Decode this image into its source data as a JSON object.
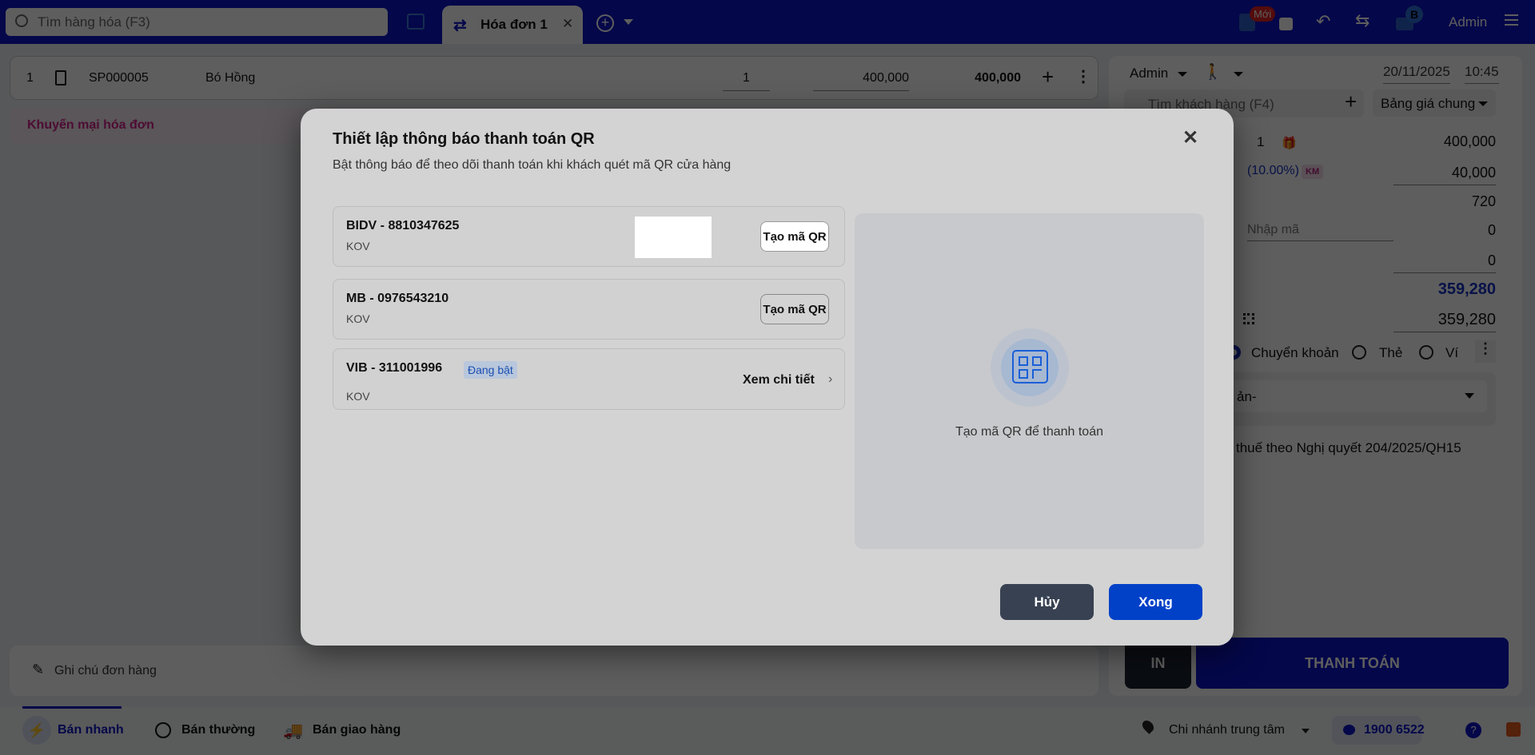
{
  "topbar": {
    "search_placeholder": "Tìm hàng hóa (F3)",
    "tab_label": "Hóa đơn 1",
    "new_badge": "Mới",
    "printer_badge": "B",
    "user": "Admin"
  },
  "cart": {
    "row": {
      "index": "1",
      "code": "SP000005",
      "name": "Bó Hồng",
      "qty": "1",
      "price": "400,000",
      "total": "400,000"
    },
    "promo_label": "Khuyến mại hóa đơn",
    "note_label": "Ghi chú đơn hàng"
  },
  "panel": {
    "staff": "Admin",
    "date": "20/11/2025",
    "time": "10:45",
    "customer_placeholder": "Tìm khách hàng (F4)",
    "price_list": "Bảng giá chung",
    "qty": "1",
    "subtotal": "400,000",
    "discount_pct": "(10.00%)",
    "km_badge": "KM",
    "discount": "40,000",
    "tax": "720",
    "coupon_placeholder": "Nhập mã",
    "coupon_value": "0",
    "other": "0",
    "payable": "359,280",
    "paid": "359,280",
    "methods": [
      "Chuyển khoản",
      "Thẻ",
      "Ví"
    ],
    "account_fragment": "ản-",
    "tax_note_fragment": "thuế theo Nghị quyết 204/2025/QH15",
    "print_label": "IN",
    "pay_label": "THANH TOÁN"
  },
  "bottom": {
    "tabs": [
      "Bán nhanh",
      "Bán thường",
      "Bán giao hàng"
    ],
    "branch": "Chi nhánh trung tâm",
    "hotline": "1900 6522"
  },
  "modal": {
    "title": "Thiết lập thông báo thanh toán QR",
    "subtitle": "Bật thông báo để theo dõi thanh toán khi khách quét mã QR cửa hàng",
    "banks": [
      {
        "name": "BIDV - 8810347625",
        "owner": "KOV",
        "action": "Tạo mã QR"
      },
      {
        "name": "MB - 0976543210",
        "owner": "KOV",
        "action": "Tạo mã QR"
      },
      {
        "name": "VIB - 311001996",
        "owner": "KOV",
        "badge": "Đang bật",
        "action": "Xem chi tiết"
      }
    ],
    "qr_hint": "Tạo mã QR để thanh toán",
    "cancel": "Hủy",
    "done": "Xong"
  },
  "colors": {
    "primary": "#0041c8",
    "topbar": "#0a12c4",
    "cancel": "#374151"
  }
}
